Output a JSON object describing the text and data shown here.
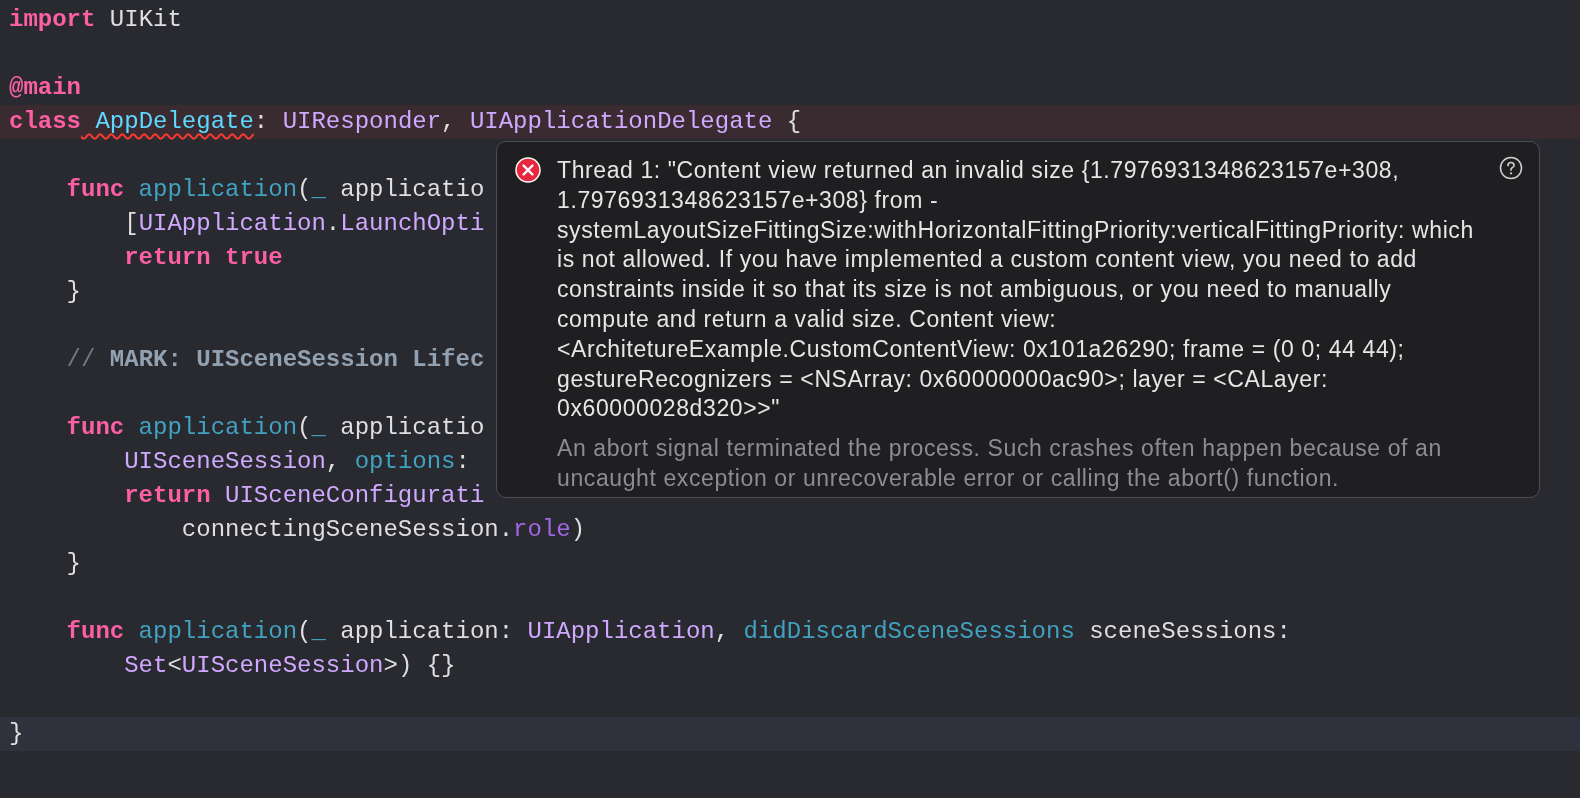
{
  "editor": {
    "lines": [
      {
        "kind": "plain",
        "tokens": [
          {
            "kind": "keyword",
            "text": "import"
          },
          {
            "kind": "plain",
            "text": " UIKit"
          }
        ]
      },
      {
        "kind": "plain"
      },
      {
        "kind": "plain",
        "tokens": [
          {
            "kind": "keyword",
            "text": "@main"
          }
        ]
      },
      {
        "kind": "error",
        "tokens": [
          {
            "kind": "keyword",
            "text": "class"
          },
          {
            "kind": "project_type",
            "text": " AppDelegate",
            "error_underline": true
          },
          {
            "kind": "plain",
            "text": ": "
          },
          {
            "kind": "type",
            "text": "UIResponder"
          },
          {
            "kind": "plain",
            "text": ", "
          },
          {
            "kind": "type",
            "text": "UIApplicationDelegate"
          },
          {
            "kind": "plain",
            "text": " {"
          }
        ]
      },
      {
        "kind": "plain"
      },
      {
        "kind": "plain",
        "tokens": [
          {
            "kind": "keyword",
            "text": "    func"
          },
          {
            "kind": "func_decl",
            "text": " application"
          },
          {
            "kind": "plain",
            "text": "("
          },
          {
            "kind": "func_decl",
            "text": "_"
          },
          {
            "kind": "plain",
            "text": " applicatio"
          }
        ]
      },
      {
        "kind": "plain",
        "tokens": [
          {
            "kind": "plain",
            "text": "        ["
          },
          {
            "kind": "type",
            "text": "UIApplication"
          },
          {
            "kind": "plain",
            "text": "."
          },
          {
            "kind": "type",
            "text": "LaunchOpti"
          }
        ]
      },
      {
        "kind": "plain",
        "tokens": [
          {
            "kind": "keyword",
            "text": "        return true"
          }
        ]
      },
      {
        "kind": "plain",
        "tokens": [
          {
            "kind": "plain",
            "text": "    }"
          }
        ]
      },
      {
        "kind": "plain"
      },
      {
        "kind": "plain",
        "tokens": [
          {
            "kind": "comment",
            "text": "    //"
          },
          {
            "kind": "mark",
            "text": " MARK: UISceneSession Lifec"
          }
        ]
      },
      {
        "kind": "plain"
      },
      {
        "kind": "plain",
        "tokens": [
          {
            "kind": "keyword",
            "text": "    func"
          },
          {
            "kind": "func_decl",
            "text": " application"
          },
          {
            "kind": "plain",
            "text": "("
          },
          {
            "kind": "func_decl",
            "text": "_"
          },
          {
            "kind": "plain",
            "text": " applicatio"
          }
        ]
      },
      {
        "kind": "plain",
        "tokens": [
          {
            "kind": "type",
            "text": "        UISceneSession"
          },
          {
            "kind": "plain",
            "text": ", "
          },
          {
            "kind": "func_decl",
            "text": "options"
          },
          {
            "kind": "plain",
            "text": ":"
          }
        ]
      },
      {
        "kind": "plain",
        "tokens": [
          {
            "kind": "keyword",
            "text": "        return"
          },
          {
            "kind": "type",
            "text": " UISceneConfigurati"
          }
        ]
      },
      {
        "kind": "plain",
        "tokens": [
          {
            "kind": "plain",
            "text": "            connectingSceneSession."
          },
          {
            "kind": "property",
            "text": "role"
          },
          {
            "kind": "plain",
            "text": ")"
          }
        ]
      },
      {
        "kind": "plain",
        "tokens": [
          {
            "kind": "plain",
            "text": "    }"
          }
        ]
      },
      {
        "kind": "plain"
      },
      {
        "kind": "plain",
        "tokens": [
          {
            "kind": "keyword",
            "text": "    func"
          },
          {
            "kind": "func_decl",
            "text": " application"
          },
          {
            "kind": "plain",
            "text": "("
          },
          {
            "kind": "func_decl",
            "text": "_"
          },
          {
            "kind": "plain",
            "text": " application: "
          },
          {
            "kind": "type",
            "text": "UIApplication"
          },
          {
            "kind": "plain",
            "text": ", "
          },
          {
            "kind": "func_decl",
            "text": "didDiscardSceneSessions"
          },
          {
            "kind": "plain",
            "text": " sceneSessions:"
          }
        ]
      },
      {
        "kind": "plain",
        "tokens": [
          {
            "kind": "type",
            "text": "        Set"
          },
          {
            "kind": "plain",
            "text": "<"
          },
          {
            "kind": "type",
            "text": "UISceneSession"
          },
          {
            "kind": "plain",
            "text": ">) {}"
          }
        ]
      },
      {
        "kind": "plain"
      },
      {
        "kind": "current",
        "tokens": [
          {
            "kind": "plain",
            "text": "}"
          }
        ]
      }
    ]
  },
  "error_popover": {
    "message": "Thread 1: \"Content view returned an invalid size {1.7976931348623157e+308, 1.7976931348623157e+308} from -systemLayoutSizeFittingSize:withHorizontalFittingPriority:verticalFittingPriority: which is not allowed. If you have implemented a custom content view, you need to add constraints inside it so that its size is not ambiguous, or you need to manually compute and return a valid size. Content view: <ArchitetureExample.CustomContentView: 0x101a26290; frame = (0 0; 44 44); gestureRecognizers = <NSArray: 0x60000000ac90>; layer = <CALayer: 0x60000028d320>>\"",
    "detail": "An abort signal terminated the process. Such crashes often happen because of an uncaught exception or unrecoverable error or calling the abort() function."
  }
}
